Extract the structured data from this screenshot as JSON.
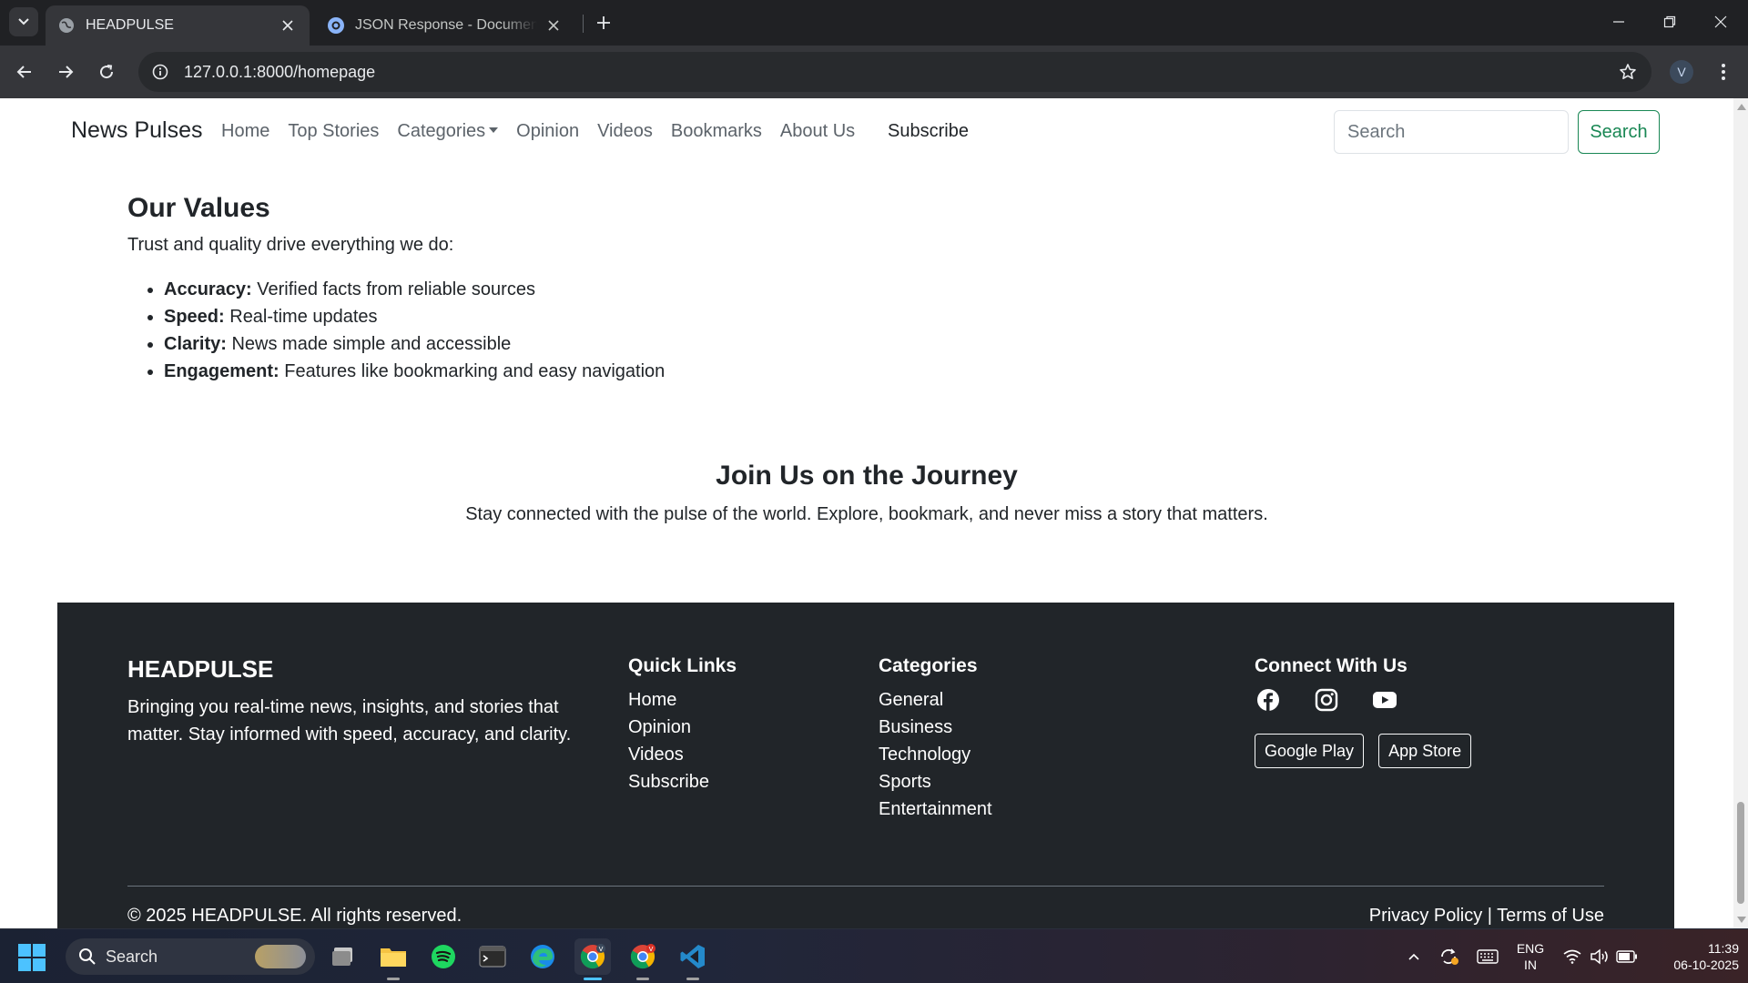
{
  "browser": {
    "tabs": [
      {
        "title": "HEADPULSE",
        "active": true
      },
      {
        "title": "JSON Response - Documentation",
        "active": false
      }
    ],
    "url": "127.0.0.1:8000/homepage",
    "profile_initial": "V"
  },
  "site_nav": {
    "brand": "News Pulses",
    "links": [
      "Home",
      "Top Stories",
      "Categories",
      "Opinion",
      "Videos",
      "Bookmarks",
      "About Us"
    ],
    "subscribe": "Subscribe",
    "search_placeholder": "Search",
    "search_button": "Search"
  },
  "values": {
    "title": "Our Values",
    "intro": "Trust and quality drive everything we do:",
    "items": [
      {
        "term": "Accuracy:",
        "text": " Verified facts from reliable sources"
      },
      {
        "term": "Speed:",
        "text": " Real-time updates"
      },
      {
        "term": "Clarity:",
        "text": " News made simple and accessible"
      },
      {
        "term": "Engagement:",
        "text": " Features like bookmarking and easy navigation"
      }
    ]
  },
  "journey": {
    "title": "Join Us on the Journey",
    "text": "Stay connected with the pulse of the world. Explore, bookmark, and never miss a story that matters."
  },
  "footer": {
    "brand": "HEADPULSE",
    "description": "Bringing you real-time news, insights, and stories that matter. Stay informed with speed, accuracy, and clarity.",
    "quick_links": {
      "heading": "Quick Links",
      "items": [
        "Home",
        "Opinion",
        "Videos",
        "Subscribe"
      ]
    },
    "categories": {
      "heading": "Categories",
      "items": [
        "General",
        "Business",
        "Technology",
        "Sports",
        "Entertainment"
      ]
    },
    "connect": {
      "heading": "Connect With Us",
      "icons": [
        "facebook-icon",
        "instagram-icon",
        "youtube-icon"
      ],
      "stores": [
        "Google Play",
        "App Store"
      ]
    },
    "copyright": "© 2025 HEADPULSE. All rights reserved.",
    "legal": "Privacy Policy | Terms of Use"
  },
  "taskbar": {
    "search": "Search",
    "lang_line1": "ENG",
    "lang_line2": "IN",
    "time": "11:39",
    "date": "06-10-2025"
  },
  "colors": {
    "accent_green": "#198754",
    "footer_bg": "#212529",
    "chrome_dark": "#202124",
    "windows_blue": "#4cc2ff"
  }
}
